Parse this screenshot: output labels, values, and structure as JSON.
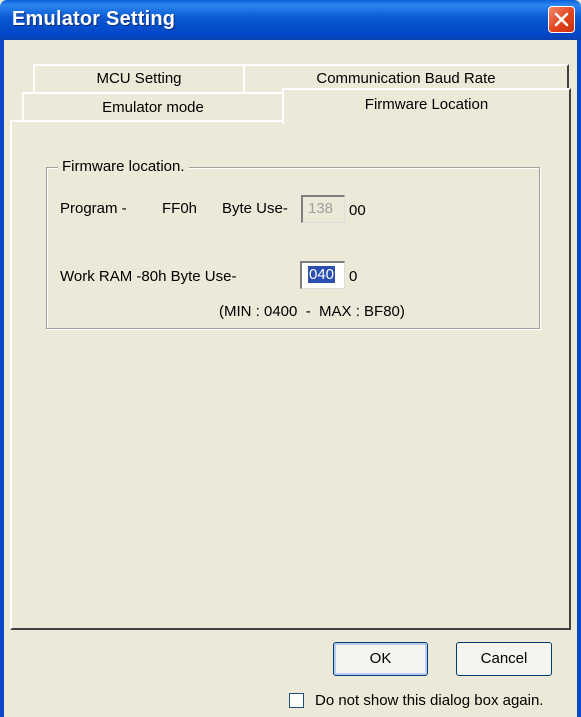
{
  "window": {
    "title": "Emulator Setting"
  },
  "tabs": {
    "row_top": [
      "MCU Setting",
      "Communication Baud Rate"
    ],
    "row_front": [
      "Emulator mode",
      "Firmware Location"
    ],
    "active": "Firmware Location"
  },
  "firmware_group": {
    "title": "Firmware location.",
    "program": {
      "label": "Program -",
      "address": "FF0h",
      "byte_use_label": "Byte Use-",
      "value": "138",
      "suffix": "00"
    },
    "work_ram": {
      "label": "Work RAM -80h Byte Use-",
      "value": "040",
      "suffix": "0"
    },
    "range_note": "(MIN : 0400  -  MAX : BF80)"
  },
  "buttons": {
    "ok": "OK",
    "cancel": "Cancel"
  },
  "dont_show_again": {
    "label": "Do not show this dialog box again.",
    "checked": false
  }
}
